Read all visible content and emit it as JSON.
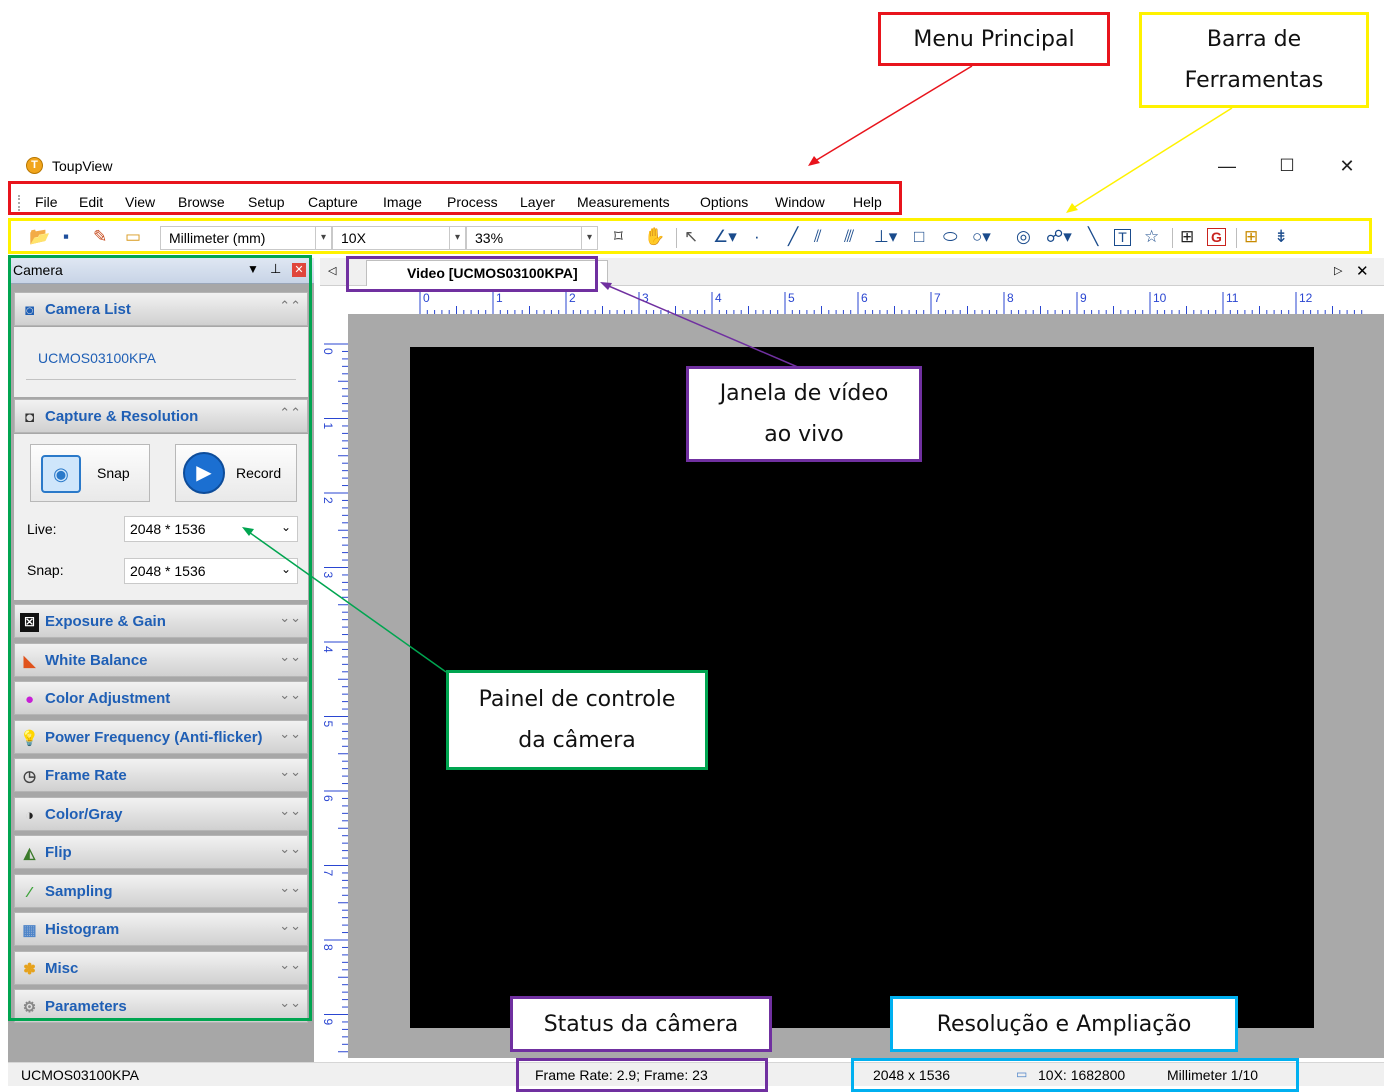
{
  "annotations": {
    "menu_principal": "Menu Principal",
    "barra_line1": "Barra de",
    "barra_line2": "Ferramentas",
    "janela_line1": "Janela de vídeo",
    "janela_line2": "ao vivo",
    "painel_line1": "Painel de controle",
    "painel_line2": "da câmera",
    "status_camera": "Status da câmera",
    "resolucao": "Resolução e Ampliação"
  },
  "window": {
    "title": "ToupView",
    "minimize": "—",
    "maximize": "☐",
    "close": "✕"
  },
  "menu": [
    "File",
    "Edit",
    "View",
    "Browse",
    "Setup",
    "Capture",
    "Image",
    "Process",
    "Layer",
    "Measurements",
    "Options",
    "Window",
    "Help"
  ],
  "toolbar": {
    "unit": "Millimeter (mm)",
    "magnification": "10X",
    "zoom": "33%"
  },
  "panel": {
    "title": "Camera",
    "camera_list": "Camera List",
    "camera_name": "UCMOS03100KPA",
    "capture_resolution": "Capture & Resolution",
    "snap_button": "Snap",
    "record_button": "Record",
    "live_label": "Live:",
    "live_value": "2048 * 1536",
    "snap_label": "Snap:",
    "snap_value": "2048 * 1536",
    "sections": [
      "Exposure & Gain",
      "White Balance",
      "Color Adjustment",
      "Power Frequency (Anti-flicker)",
      "Frame Rate",
      "Color/Gray",
      "Flip",
      "Sampling",
      "Histogram",
      "Misc",
      "Parameters"
    ]
  },
  "video": {
    "tab_label": "Video [UCMOS03100KPA]",
    "hruler_ticks": [
      "0",
      "1",
      "2",
      "3",
      "4",
      "5",
      "6",
      "7",
      "8",
      "9",
      "10",
      "11",
      "12"
    ],
    "vruler_ticks": [
      "0",
      "1",
      "2",
      "3",
      "4",
      "5",
      "6",
      "7",
      "8",
      "9"
    ]
  },
  "status": {
    "camera": "UCMOS03100KPA",
    "frame": "Frame Rate: 2.9; Frame: 23",
    "resolution": "2048 x 1536",
    "magnification": "10X: 1682800",
    "unit": "Millimeter 1/10"
  }
}
